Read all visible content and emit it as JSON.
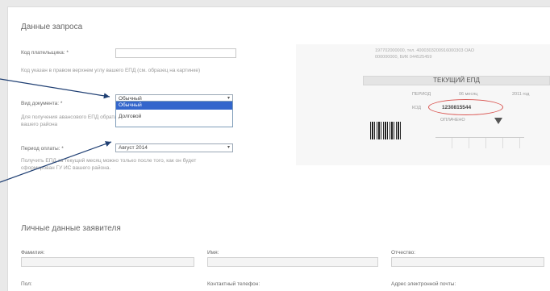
{
  "request": {
    "title": "Данные запроса",
    "payer_code_label": "Код плательщика: *",
    "payer_code_value": "",
    "payer_code_note": "Код указан в правом верхнем углу вашего ЕПД (см. образец на картинке)",
    "doc_type_label": "Вид документа: *",
    "doc_type_selected": "Обычный",
    "doc_type_options": [
      "Обычный",
      "Долговой"
    ],
    "doc_type_note": "Для получения авансового ЕПД обратиться в ГУ ИС вашего района",
    "period_label": "Период оплаты: *",
    "period_selected": "Август 2014",
    "period_note": "Получить ЕПД за текущий месяц можно только после того, как он будет сформирован ГУ ИС вашего района."
  },
  "preview": {
    "line1": "197702000000, тел. 4000303200916000303 ОАО",
    "line2": "000000000, БИК 044525459",
    "title": "ТЕКУЩИЙ ЕПД",
    "period_label": "ПЕРИОД",
    "period_month": "06  месяц",
    "period_year": "2011 год",
    "code_label": "КОД",
    "code_value": "1230815544",
    "extra_label": "ОПЛАЧЕНО"
  },
  "applicant": {
    "title": "Личные данные заявителя",
    "last_name_label": "Фамилия:",
    "first_name_label": "Имя:",
    "middle_name_label": "Отчество:",
    "gender_label": "Пол:",
    "phone_label": "Контактный телефон:",
    "email_label": "Адрес электронной почты:"
  },
  "colors": {
    "accent": "#3366cc",
    "highlight": "#d9534f",
    "arrow": "#1f3f73"
  }
}
